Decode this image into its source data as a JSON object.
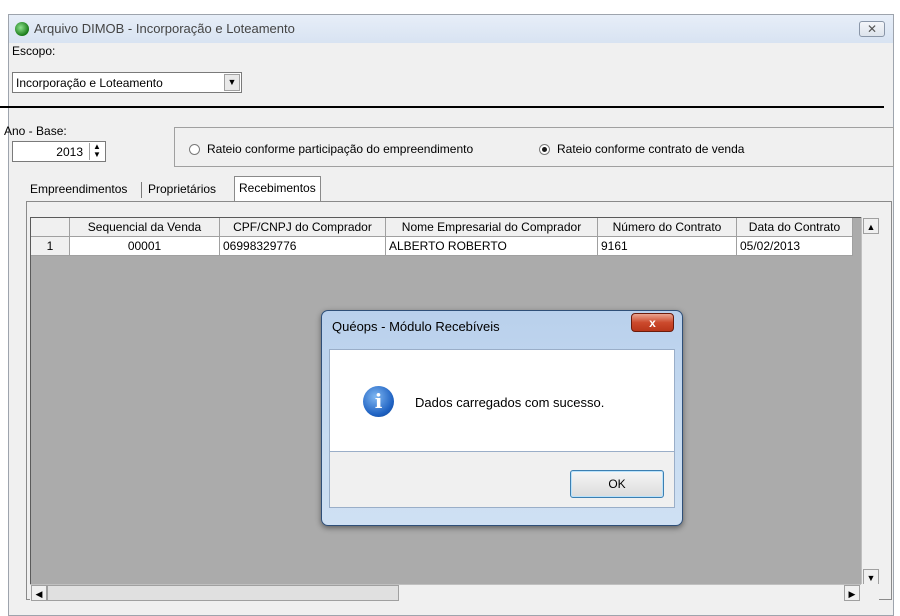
{
  "window": {
    "title": "Arquivo DIMOB - Incorporação e Loteamento",
    "close_glyph": "✕"
  },
  "escopo": {
    "label": "Escopo:",
    "value": "Incorporação e Loteamento"
  },
  "ano_base": {
    "label": "Ano - Base:",
    "value": "2013"
  },
  "rateio": {
    "option1": "Rateio conforme participação do empreendimento",
    "option2": "Rateio conforme contrato de venda",
    "selected": 2
  },
  "tabs": [
    "Empreendimentos",
    "Proprietários",
    "Recebimentos"
  ],
  "active_tab": "Recebimentos",
  "table": {
    "headers": [
      "",
      "Sequencial da Venda",
      "CPF/CNPJ do Comprador",
      "Nome Empresarial do Comprador",
      "Número do Contrato",
      "Data do Contrato"
    ],
    "rows": [
      [
        "1",
        "00001",
        "06998329776",
        "ALBERTO ROBERTO",
        "9161",
        "05/02/2013"
      ]
    ]
  },
  "dialog": {
    "title": "Quéops - Módulo Recebíveis",
    "close_glyph": "x",
    "message": "Dados carregados com sucesso.",
    "ok_label": "OK",
    "icon": "info-icon"
  }
}
